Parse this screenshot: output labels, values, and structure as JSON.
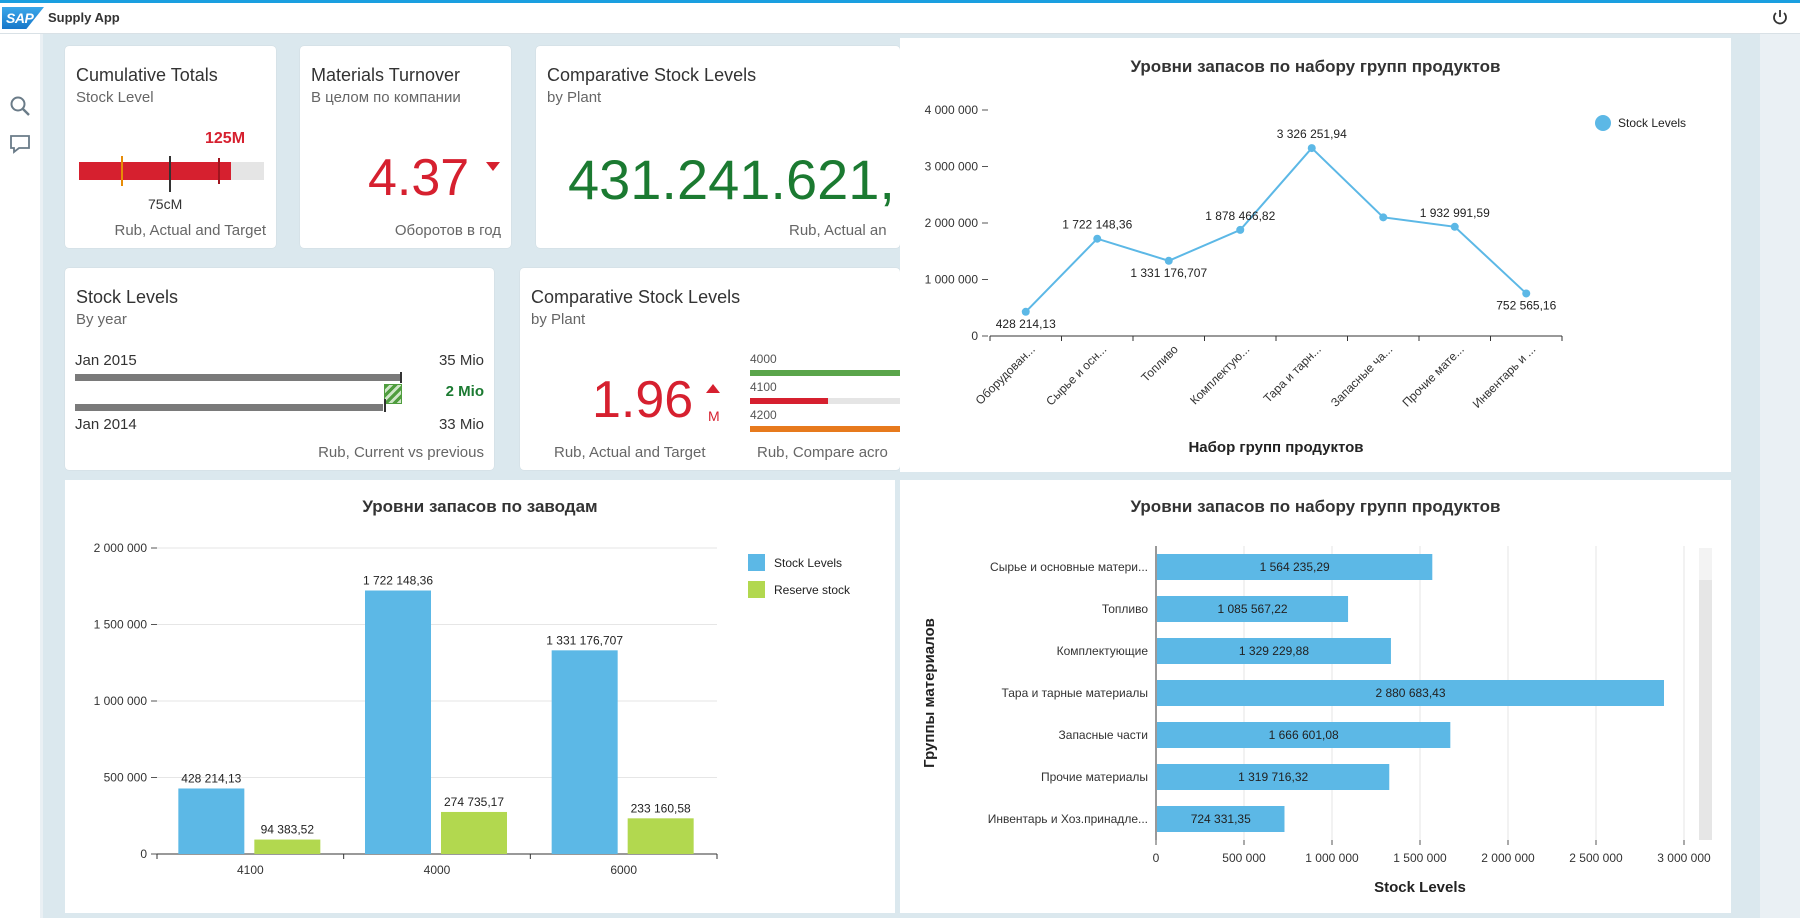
{
  "shell": {
    "logo_text": "SAP",
    "app_title": "Supply App"
  },
  "tiles": {
    "cumulative": {
      "title": "Cumulative Totals",
      "subtitle": "Stock Level",
      "target_label": "125M",
      "actual_label": "75cM",
      "footer": "Rub, Actual and Target",
      "actual_fraction": 0.82,
      "colors": {
        "bar": "#d6202f",
        "track": "#e5e5e5",
        "marker": "#e78c07"
      }
    },
    "turnover": {
      "title": "Materials Turnover",
      "subtitle": "В целом по компании",
      "value": "4.37",
      "trend": "down",
      "footer": "Оборотов в год",
      "color": "#d6202f"
    },
    "comparative1": {
      "title": "Comparative Stock Levels",
      "subtitle": "by Plant",
      "value": "431.241.621,",
      "footer": "Rub, Actual an",
      "color": "#1b7a31"
    },
    "stock_levels": {
      "title": "Stock Levels",
      "subtitle": "By year",
      "row1_label": "Jan 2015",
      "row1_value": "35 Mio",
      "delta": "2 Mio",
      "row2_label": "Jan 2014",
      "row2_value": "33 Mio",
      "footer": "Rub, Current vs previous",
      "row1_fraction": 1.0,
      "row2_fraction": 0.943
    },
    "comparative2": {
      "title": "Comparative Stock Levels",
      "subtitle": "by Plant",
      "value": "1.96",
      "unit": "M",
      "trend": "up",
      "footer_left": "Rub, Actual and Target",
      "footer_right": "Rub, Compare acro",
      "bars": [
        {
          "label": "4000",
          "color": "#5aa54b",
          "fraction": 1.0
        },
        {
          "label": "4100",
          "color": "#d6202f",
          "fraction": 0.5
        },
        {
          "label": "4200",
          "color": "#e77a1d",
          "fraction": 1.0
        }
      ]
    }
  },
  "chart_data": [
    {
      "type": "line",
      "title": "Уровни запасов по набору групп продуктов",
      "xlabel": "Набор групп продуктов",
      "ylabel": "",
      "categories": [
        "Оборудован...",
        "Сырье и осн...",
        "Топливо",
        "Комплектую...",
        "Тара и тарн...",
        "Запасные ча...",
        "Прочие мате...",
        "Инвентарь и ..."
      ],
      "series": [
        {
          "name": "Stock Levels",
          "values": [
            428214.13,
            1722148.36,
            1331176.707,
            1878466.82,
            3326251.94,
            2100000,
            1932991.59,
            752565.16
          ]
        }
      ],
      "data_labels": [
        "428 214,13",
        "1 722 148,36",
        "1 331 176,707",
        "1 878 466,82",
        "3 326 251,94",
        "",
        "1 932 991,59",
        "752 565,16"
      ],
      "y_ticks": [
        "0",
        "1 000 000",
        "2 000 000",
        "3 000 000",
        "4 000 000"
      ],
      "ylim": [
        0,
        4000000
      ],
      "legend": "top-right",
      "color": "#5cb8e6"
    },
    {
      "type": "bar",
      "title": "Уровни запасов по заводам",
      "xlabel": "",
      "ylabel": "",
      "categories": [
        "4100",
        "4000",
        "6000"
      ],
      "series": [
        {
          "name": "Stock Levels",
          "color": "#5cb8e6",
          "values": [
            428214.13,
            1722148.36,
            1331176.707
          ],
          "labels": [
            "428 214,13",
            "1 722 148,36",
            "1 331 176,707"
          ]
        },
        {
          "name": "Reserve stock",
          "color": "#b2d84f",
          "values": [
            94383.52,
            274735.17,
            233160.58
          ],
          "labels": [
            "94 383,52",
            "274 735,17",
            "233 160,58"
          ]
        }
      ],
      "y_ticks": [
        "0",
        "500 000",
        "1 000 000",
        "1 500 000",
        "2 000 000"
      ],
      "ylim": [
        0,
        2000000
      ],
      "legend": "top-right"
    },
    {
      "type": "bar",
      "orientation": "horizontal",
      "title": "Уровни запасов по набору групп продуктов",
      "xlabel": "Stock Levels",
      "ylabel": "Группы материалов",
      "categories": [
        "Сырье и основные матери...",
        "Топливо",
        "Комплектующие",
        "Тара и тарные материалы",
        "Запасные части",
        "Прочие материалы",
        "Инвентарь и Хоз.принадле..."
      ],
      "series": [
        {
          "name": "Stock Levels",
          "values": [
            1564235.29,
            1085567.22,
            1329229.88,
            2880683.43,
            1666601.08,
            1319716.32,
            724331.35
          ]
        }
      ],
      "data_labels": [
        "1 564 235,29",
        "1 085 567,22",
        "1 329 229,88",
        "2 880 683,43",
        "1 666 601,08",
        "1 319 716,32",
        "724 331,35"
      ],
      "x_ticks": [
        "0",
        "500 000",
        "1 000 000",
        "1 500 000",
        "2 000 000",
        "2 500 000",
        "3 000 000"
      ],
      "xlim": [
        0,
        3000000
      ],
      "color": "#5cb8e6",
      "grid": true
    }
  ]
}
